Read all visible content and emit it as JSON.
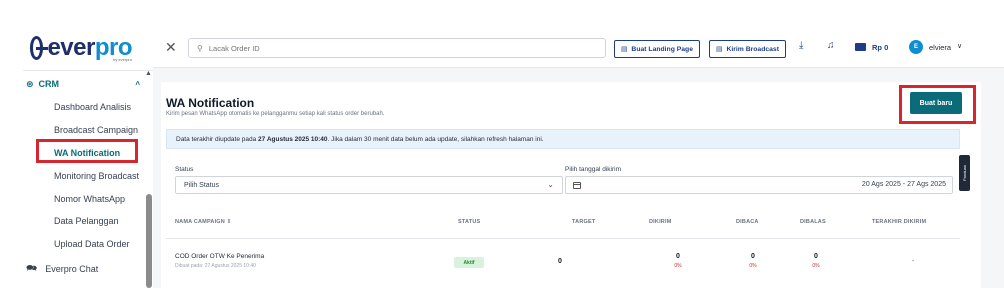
{
  "brand": {
    "logo_prefix": "ever",
    "logo_suffix": "pro",
    "logo_tagline": "by everpro"
  },
  "sidebar": {
    "section_label": "CRM",
    "items": [
      {
        "label": "Dashboard Analisis"
      },
      {
        "label": "Broadcast Campaign"
      },
      {
        "label": "WA Notification"
      },
      {
        "label": "Monitoring Broadcast"
      },
      {
        "label": "Nomor WhatsApp"
      },
      {
        "label": "Data Pelanggan"
      },
      {
        "label": "Upload Data Order"
      }
    ],
    "chat_label": "Everpro Chat"
  },
  "topbar": {
    "search_placeholder": "Lacak Order ID",
    "landing_button": "Buat Landing Page",
    "broadcast_button": "Kirim Broadcast",
    "balance": "Rp 0",
    "avatar_initial": "E",
    "username": "elviera"
  },
  "page": {
    "title": "WA Notification",
    "subtitle": "Kirim pesan WhatsApp otomatis ke pelangganmu setiap kali status order berubah.",
    "new_button": "Buat baru",
    "info_prefix": "Data terakhir diupdate pada ",
    "info_date": "27 Agustus 2025 10:40",
    "info_suffix": ". Jika dalam 30 menit data belum ada update, silahkan refresh halaman ini.",
    "side_tab": "Panduan"
  },
  "filters": {
    "status_label": "Status",
    "status_value": "Pilih Status",
    "date_label": "Pilih tanggal dikirim",
    "date_value": "20 Ags 2025 - 27 Ags 2025"
  },
  "table": {
    "columns": [
      "NAMA CAMPAIGN",
      "STATUS",
      "TARGET",
      "DIKIRIM",
      "DIBACA",
      "DIBALAS",
      "TERAKHIR DIKIRIM"
    ],
    "rows": [
      {
        "name": "COD Order OTW Ke Penerima",
        "created": "Dibuat pada: 27 Agustus 2025 10:40",
        "status": "Aktif",
        "target": "0",
        "sent": "0",
        "sent_pct": "0%",
        "read": "0",
        "read_pct": "0%",
        "replied": "0",
        "replied_pct": "0%",
        "last_sent": "-"
      }
    ]
  },
  "colors": {
    "primary": "#0b6b78",
    "navy": "#1f3c88",
    "highlight": "#d6262f",
    "status_ok": "#1e8a3a"
  }
}
